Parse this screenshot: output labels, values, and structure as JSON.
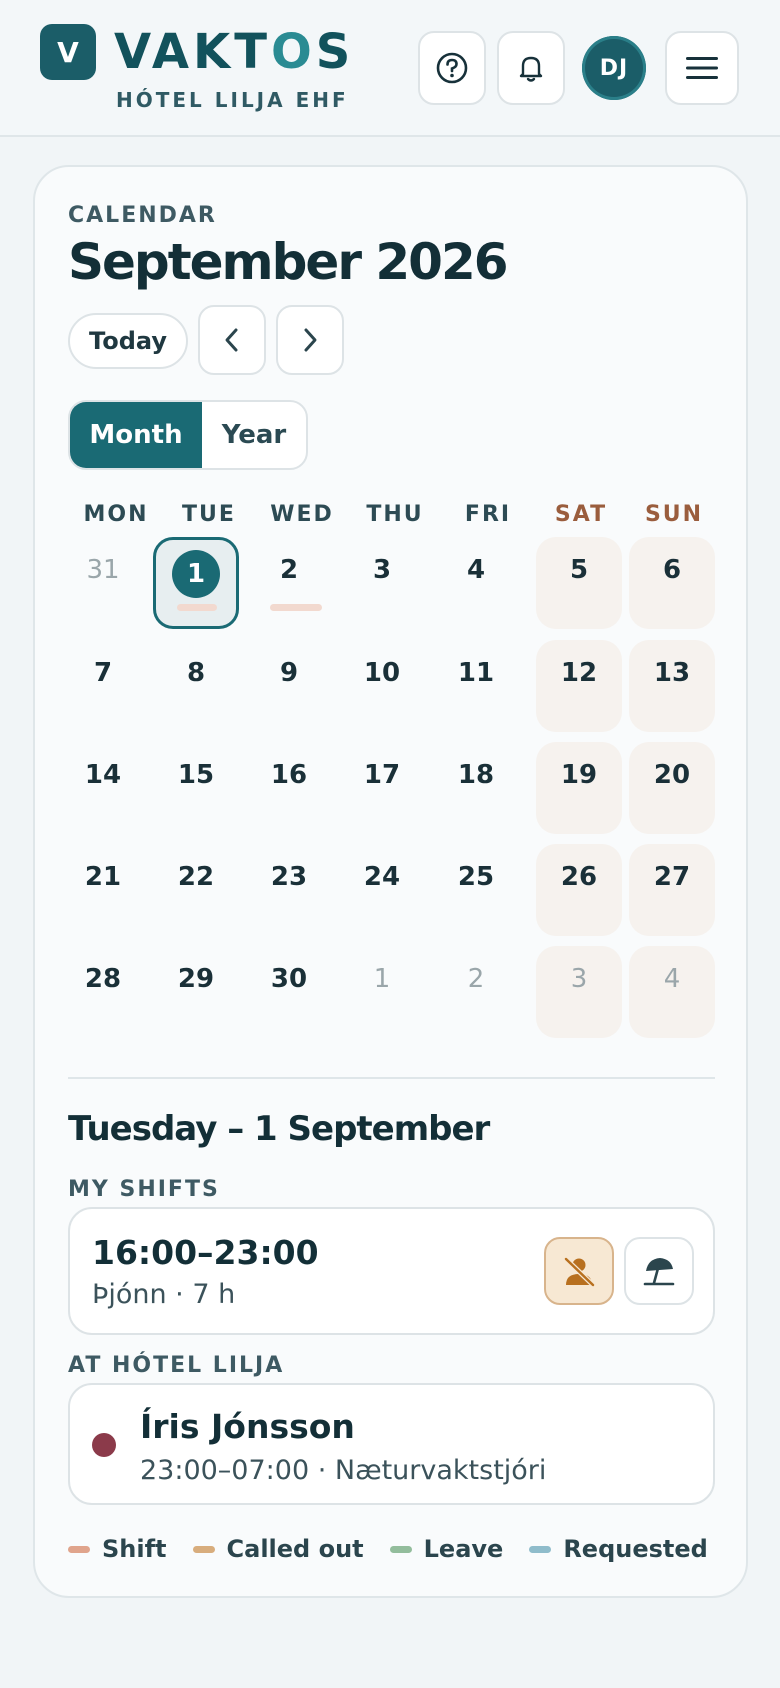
{
  "header": {
    "logo_letter": "V",
    "brand_prefix": "VAKT",
    "brand_o": "O",
    "brand_suffix": "S",
    "subtitle": "HÓTEL LILJA EHF",
    "help_icon": "help-circle-icon",
    "notifications_icon": "bell-icon",
    "avatar_initials": "DJ",
    "menu_icon": "hamburger-menu-icon"
  },
  "calendar": {
    "eyebrow": "CALENDAR",
    "title": "September 2026",
    "today_label": "Today",
    "prev_icon": "chevron-left-icon",
    "next_icon": "chevron-right-icon",
    "view_month": "Month",
    "view_year": "Year",
    "weekdays": [
      "MON",
      "TUE",
      "WED",
      "THU",
      "FRI",
      "SAT",
      "SUN"
    ],
    "weeks": [
      [
        "31",
        "1",
        "2",
        "3",
        "4",
        "5",
        "6"
      ],
      [
        "7",
        "8",
        "9",
        "10",
        "11",
        "12",
        "13"
      ],
      [
        "14",
        "15",
        "16",
        "17",
        "18",
        "19",
        "20"
      ],
      [
        "21",
        "22",
        "23",
        "24",
        "25",
        "26",
        "27"
      ],
      [
        "28",
        "29",
        "30",
        "1",
        "2",
        "3",
        "4"
      ]
    ]
  },
  "selected_day": {
    "title": "Tuesday – 1 September",
    "my_shifts_label": "MY SHIFTS",
    "shift_time": "16:00–23:00",
    "shift_detail": "Þjónn · 7 h",
    "call_out_icon": "person-off-icon",
    "leave_icon": "beach-umbrella-icon",
    "at_label": "AT HÓTEL LILJA",
    "colleague_name": "Íris Jónsson",
    "colleague_detail": "23:00–07:00 · Næturvaktstjóri"
  },
  "legend": [
    {
      "label": "Shift",
      "color": "#e0a48c"
    },
    {
      "label": "Called out",
      "color": "#d8ad7d"
    },
    {
      "label": "Leave",
      "color": "#93bd9c"
    },
    {
      "label": "Requested",
      "color": "#8fbccb"
    }
  ],
  "colors": {
    "brand": "#1b5d68",
    "accent": "#1a6a74",
    "weekend_bg": "#f6f2ee",
    "colleague_dot": "#8b3a4a"
  }
}
